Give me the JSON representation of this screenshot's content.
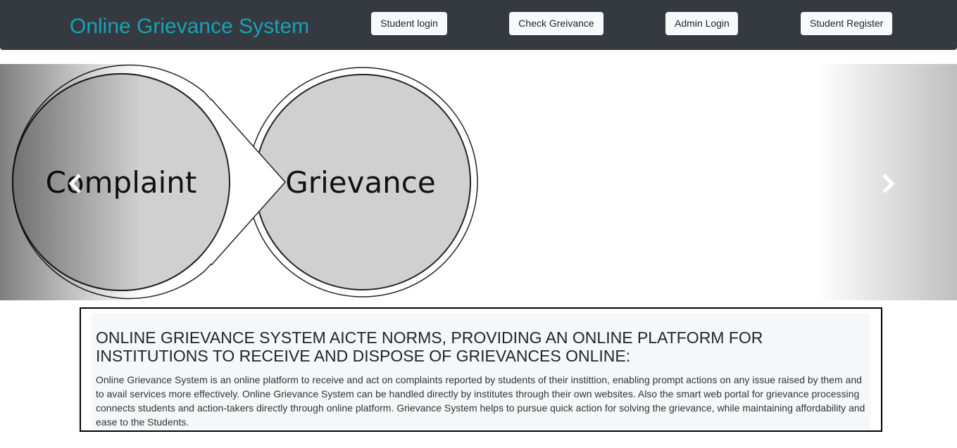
{
  "navbar": {
    "brand": "Online Grievance System",
    "buttons": {
      "student_login": "Student login",
      "check_grievance": "Check Greivance",
      "admin_login": "Admin Login",
      "student_register": "Student Register"
    }
  },
  "carousel": {
    "slide": {
      "left_word": "Complaint",
      "right_word": "Grievance"
    },
    "prev_icon": "chevron-left-icon",
    "next_icon": "chevron-right-icon"
  },
  "info": {
    "heading": "ONLINE GRIEVANCE SYSTEM AICTE NORMS, PROVIDING AN ONLINE PLATFORM FOR INSTITUTIONS TO RECEIVE AND DISPOSE OF GRIEVANCES ONLINE:",
    "body": "Online Grievance System is an online platform to receive and act on complaints reported by students of their instittion, enabling prompt actions on any issue raised by them and to avail services more effectively. Online Grievance System can be handled directly by institutes through their own websites. Also the smart web portal for grievance processing connects students and action-takers directly through online platform. Grievance System helps to pursue quick action for solving the grievance, while maintaining affordability and ease to the Students."
  },
  "colors": {
    "navbar_bg": "#343a40",
    "brand": "#17a2b8",
    "button_bg": "#f8f9fa",
    "circle_fill": "#d0d0d0"
  }
}
